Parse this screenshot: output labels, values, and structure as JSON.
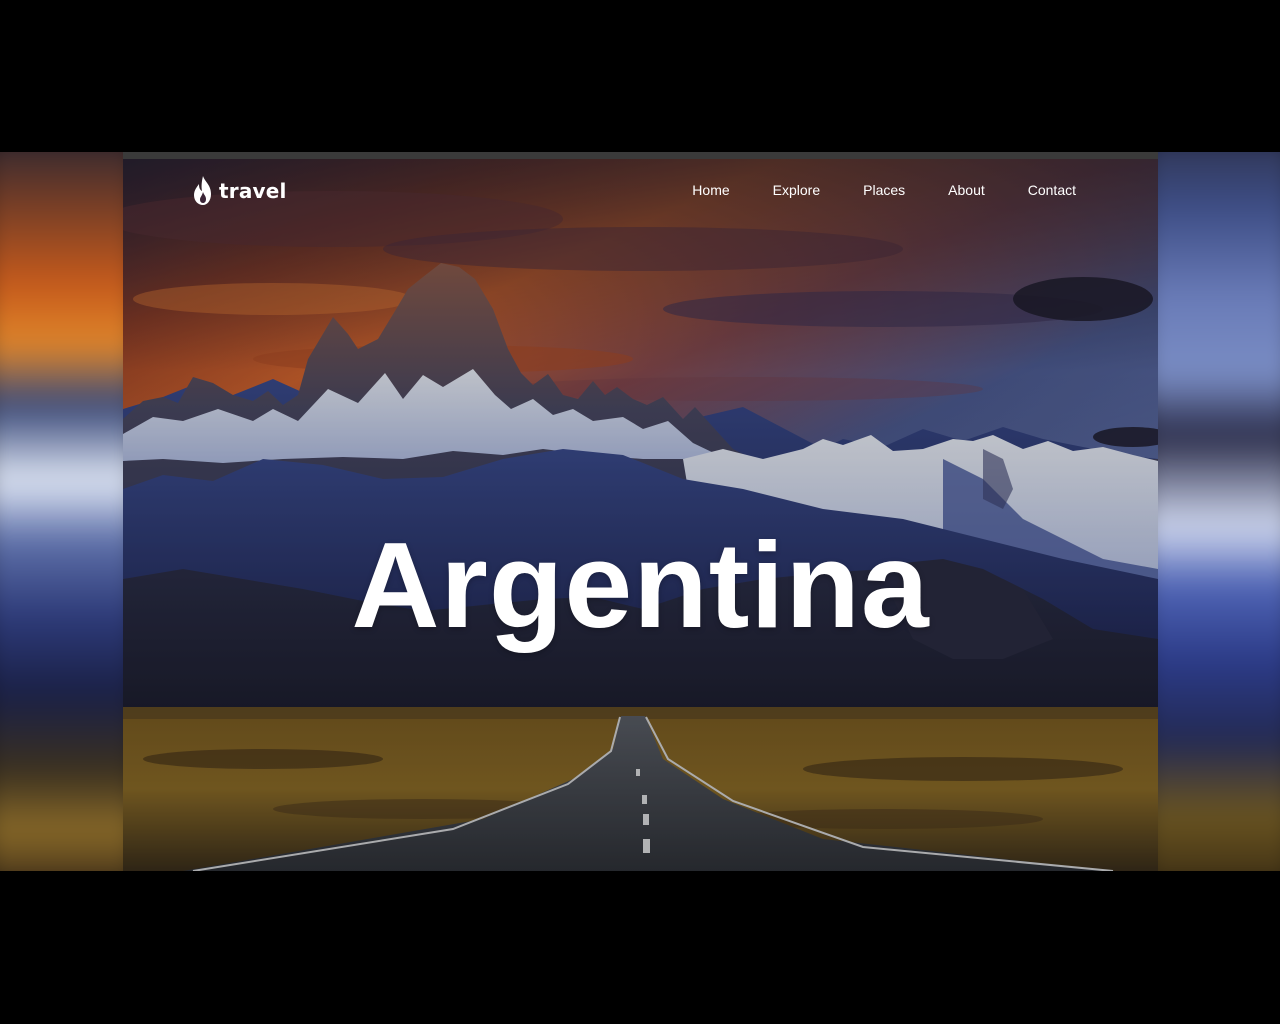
{
  "brand": {
    "name": "travel",
    "icon": "flame-icon"
  },
  "nav": {
    "items": [
      {
        "label": "Home"
      },
      {
        "label": "Explore"
      },
      {
        "label": "Places"
      },
      {
        "label": "About"
      },
      {
        "label": "Contact"
      }
    ]
  },
  "hero": {
    "title": "Argentina"
  },
  "colors": {
    "letterbox": "#000000",
    "text": "#ffffff",
    "sky_warm": "#d9652a",
    "sky_cool": "#3c4f86",
    "snow": "#e8edf7",
    "grass": "#8c6a22",
    "road": "#3a3d42"
  }
}
